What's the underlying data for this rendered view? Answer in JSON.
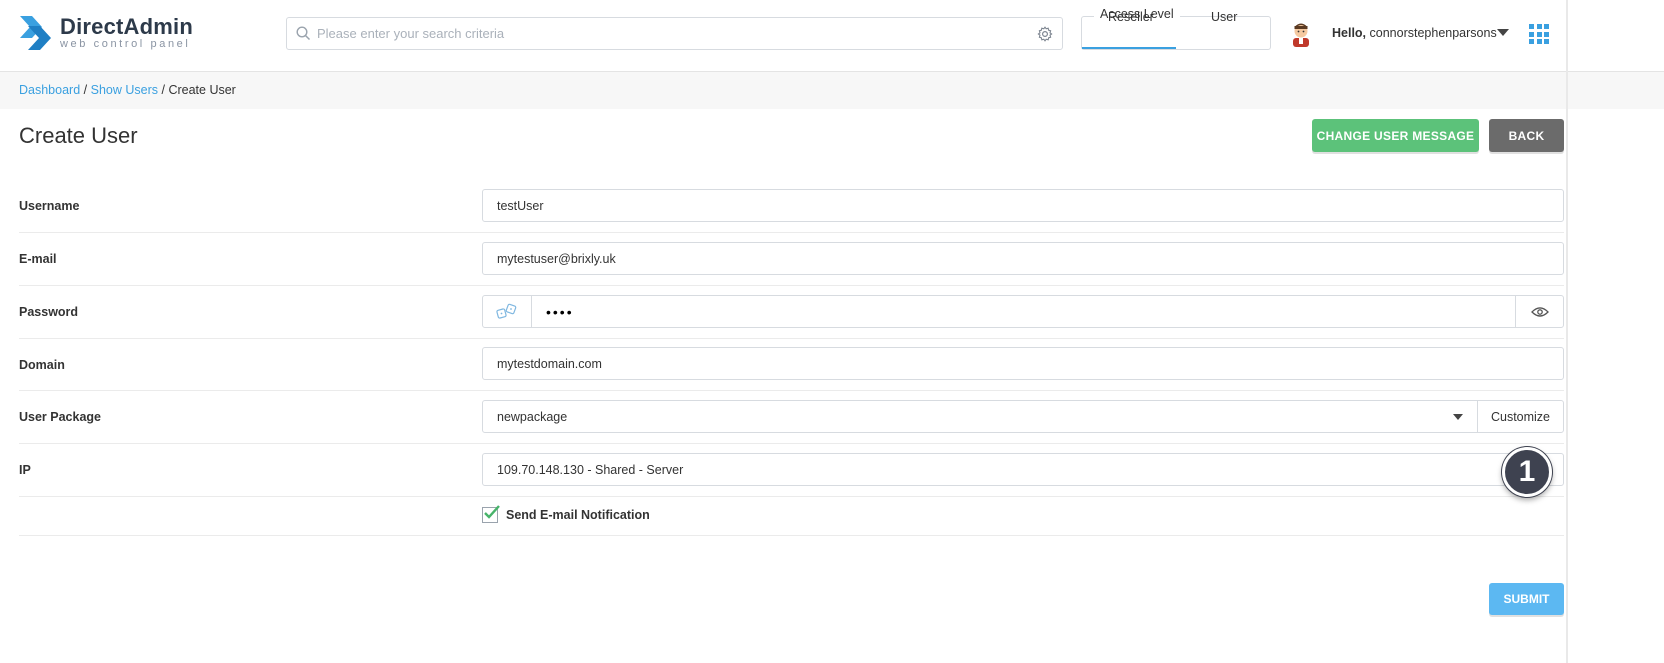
{
  "header": {
    "logo_title": "DirectAdmin",
    "logo_subtitle": "web control panel",
    "search_placeholder": "Please enter your search criteria",
    "access_level_label": "Access Level",
    "access_tabs": [
      "Reseller",
      "User"
    ],
    "access_active": "Reseller",
    "hello_prefix": "Hello,",
    "username": "connorstephenparsons",
    "accent_color": "#3aa0e0"
  },
  "breadcrumb": {
    "items": [
      "Dashboard",
      "Show Users"
    ],
    "separator": "/",
    "current": "Create User"
  },
  "page": {
    "title": "Create User",
    "change_message_label": "CHANGE USER MESSAGE",
    "back_label": "BACK",
    "submit_label": "SUBMIT"
  },
  "form": {
    "username_label": "Username",
    "username_value": "testUser",
    "email_label": "E-mail",
    "email_value": "mytestuser@brixly.uk",
    "password_label": "Password",
    "password_value": "••••",
    "domain_label": "Domain",
    "domain_value": "mytestdomain.com",
    "package_label": "User Package",
    "package_value": "newpackage",
    "customize_label": "Customize",
    "ip_label": "IP",
    "ip_value": "109.70.148.130 - Shared - Server",
    "notify_label": "Send E-mail Notification",
    "notify_checked": true
  },
  "annotation": {
    "marker": "1"
  }
}
